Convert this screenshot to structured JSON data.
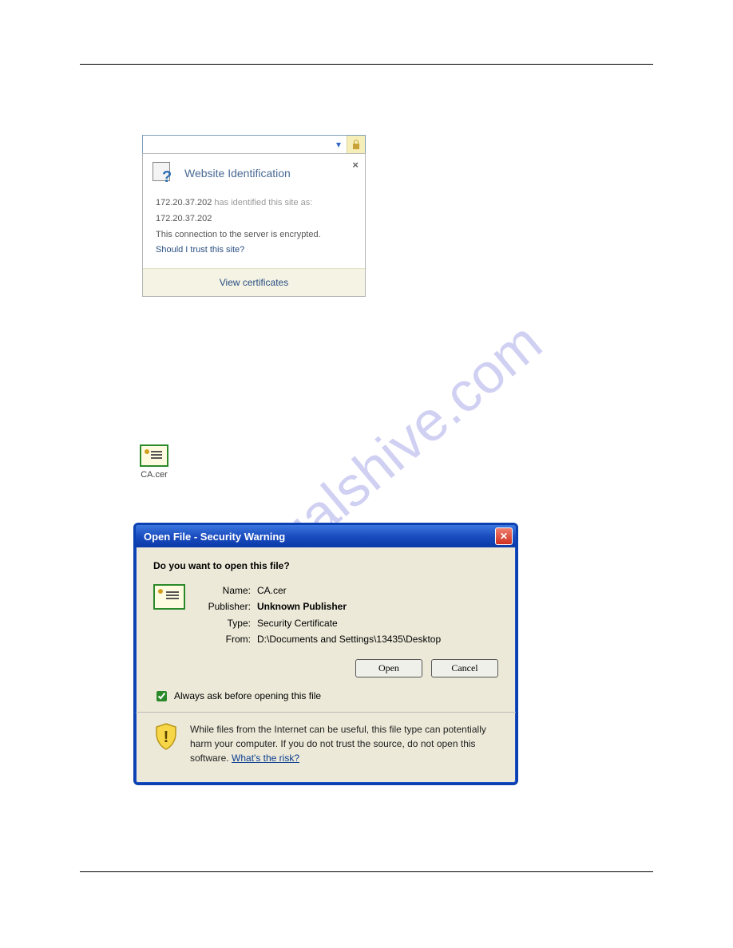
{
  "watermark": "manualshive.com",
  "website_ident": {
    "title": "Website Identification",
    "ip_source": "172.20.37.202",
    "has_identified": "has identified this site as:",
    "ip_target": "172.20.37.202",
    "encrypted_msg": "This connection to the server is encrypted.",
    "trust_link": "Should I trust this site?",
    "view_certs": "View certificates"
  },
  "cert_file": {
    "label": "CA.cer"
  },
  "security_dialog": {
    "title": "Open File - Security Warning",
    "question": "Do you want to open this file?",
    "fields": {
      "name_label": "Name:",
      "name_value": "CA.cer",
      "publisher_label": "Publisher:",
      "publisher_value": "Unknown Publisher",
      "type_label": "Type:",
      "type_value": "Security Certificate",
      "from_label": "From:",
      "from_value": "D:\\Documents and Settings\\13435\\Desktop"
    },
    "buttons": {
      "open": "Open",
      "cancel": "Cancel"
    },
    "always_ask": "Always ask before opening this file",
    "warning_text": "While files from the Internet can be useful, this file type can potentially harm your computer. If you do not trust the source, do not open this software. ",
    "risk_link": "What's the risk?"
  }
}
